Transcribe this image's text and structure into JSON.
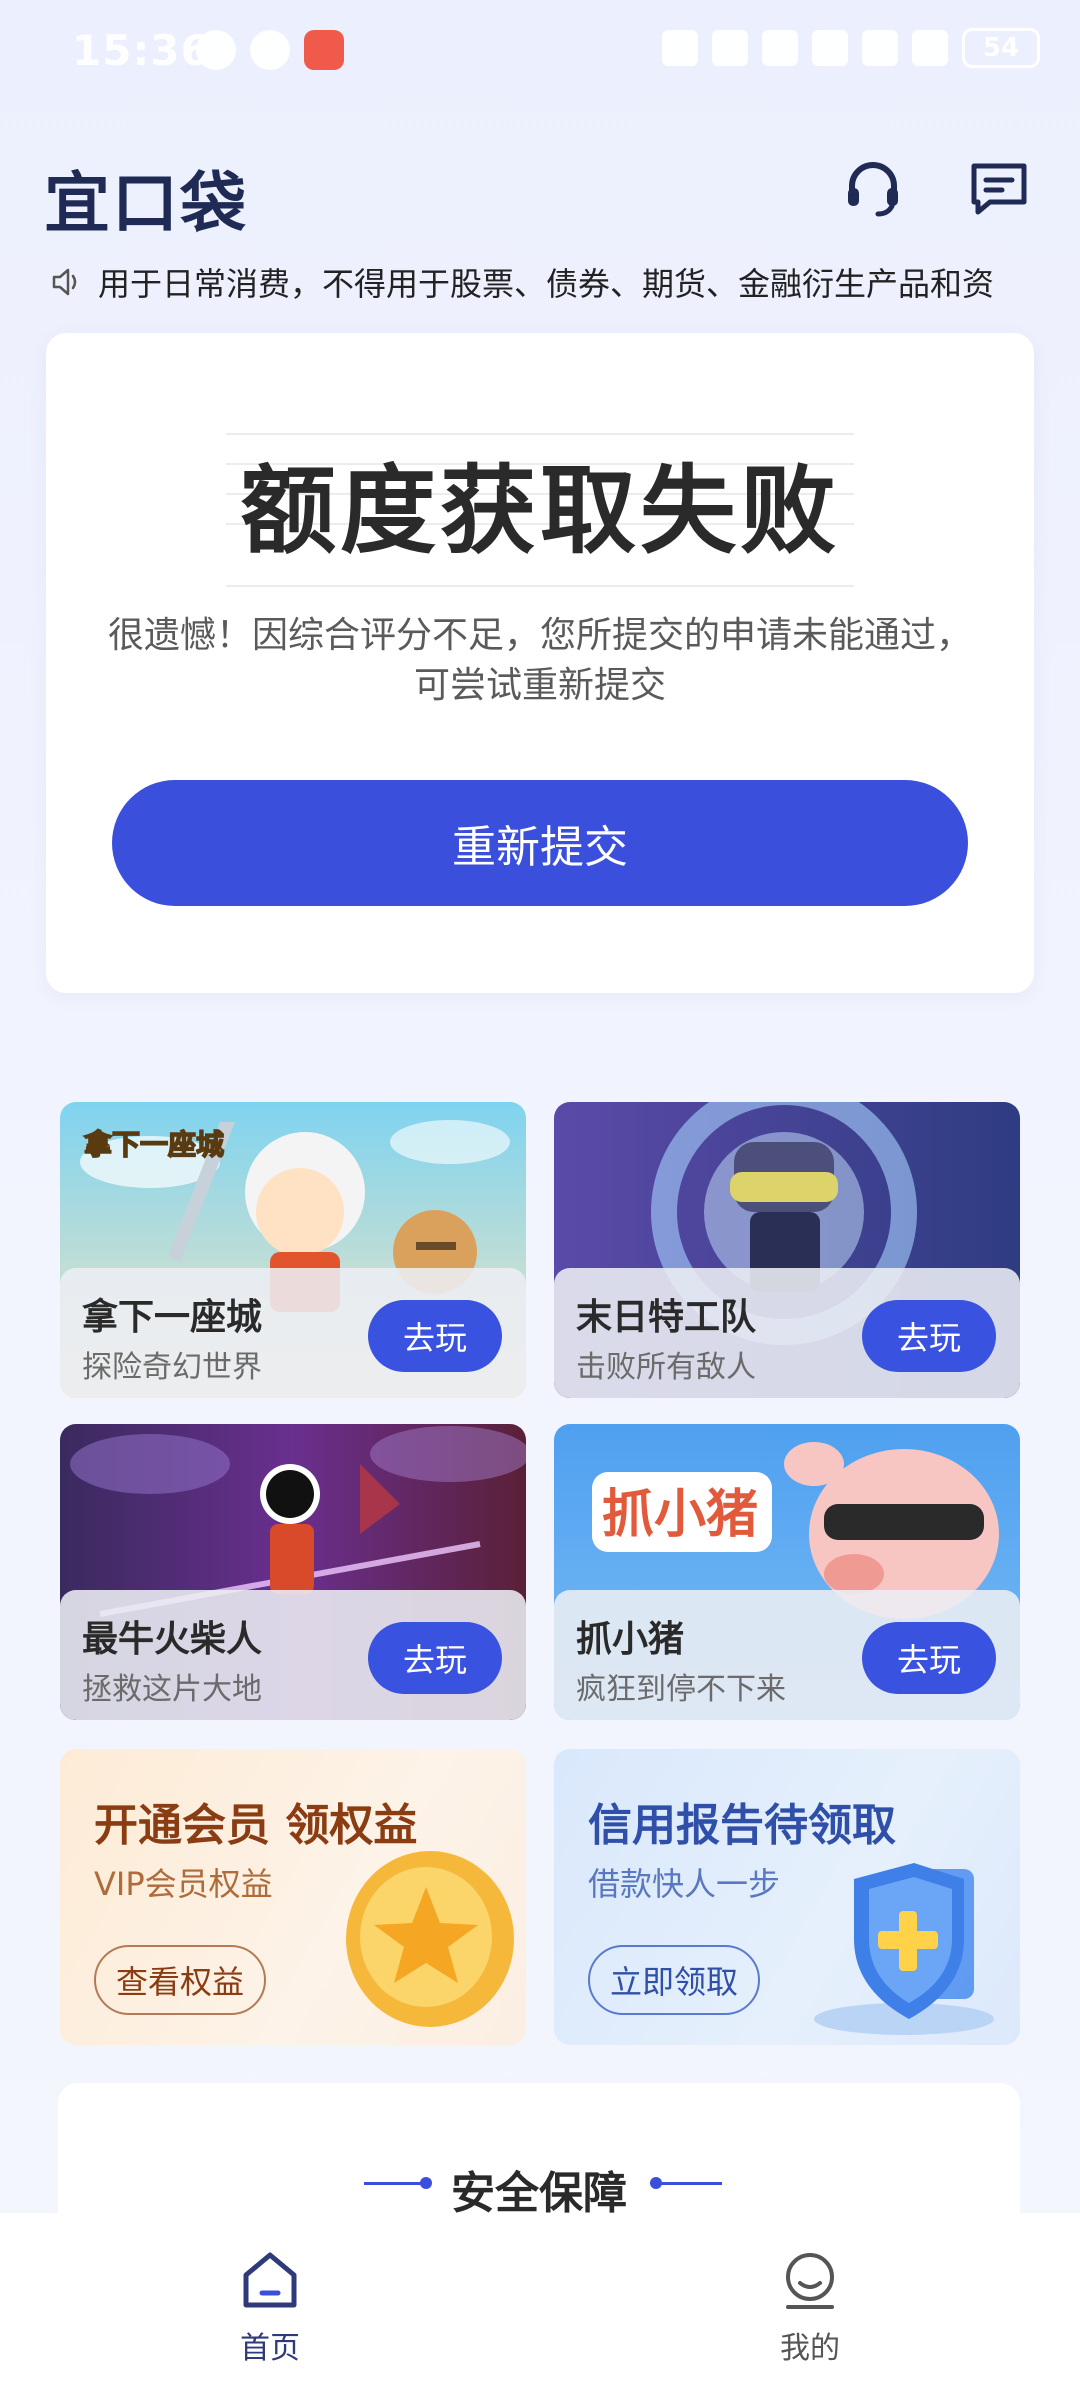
{
  "status_bar": {
    "time": "15:36",
    "battery": "54"
  },
  "header": {
    "logo": "宜口袋"
  },
  "notice": {
    "text": "用于日常消费，不得用于股票、债券、期货、金融衍生产品和资"
  },
  "result": {
    "title": "额度获取失败",
    "description": "很遗憾！因综合评分不足，您所提交的申请未能通过，可尝试重新提交",
    "button_label": "重新提交"
  },
  "games": [
    {
      "name": "拿下一座城",
      "sub": "探险奇幻世界",
      "button": "去玩",
      "art_text": "拿下一座城"
    },
    {
      "name": "末日特工队",
      "sub": "击败所有敌人",
      "button": "去玩"
    },
    {
      "name": "最牛火柴人",
      "sub": "拯救这片大地",
      "button": "去玩"
    },
    {
      "name": "抓小猪",
      "sub": "疯狂到停不下来",
      "button": "去玩",
      "art_text": "抓小猪"
    }
  ],
  "promos": [
    {
      "title": "开通会员 领权益",
      "sub": "VIP会员权益",
      "button": "查看权益"
    },
    {
      "title": "信用报告待领取",
      "sub": "借款快人一步",
      "button": "立即领取"
    }
  ],
  "security": {
    "title": "安全保障"
  },
  "nav": [
    {
      "label": "首页"
    },
    {
      "label": "我的"
    }
  ],
  "colors": {
    "accent": "#3b4fdd",
    "nav_active": "#2f3a7a",
    "nav_inactive": "#555555"
  }
}
